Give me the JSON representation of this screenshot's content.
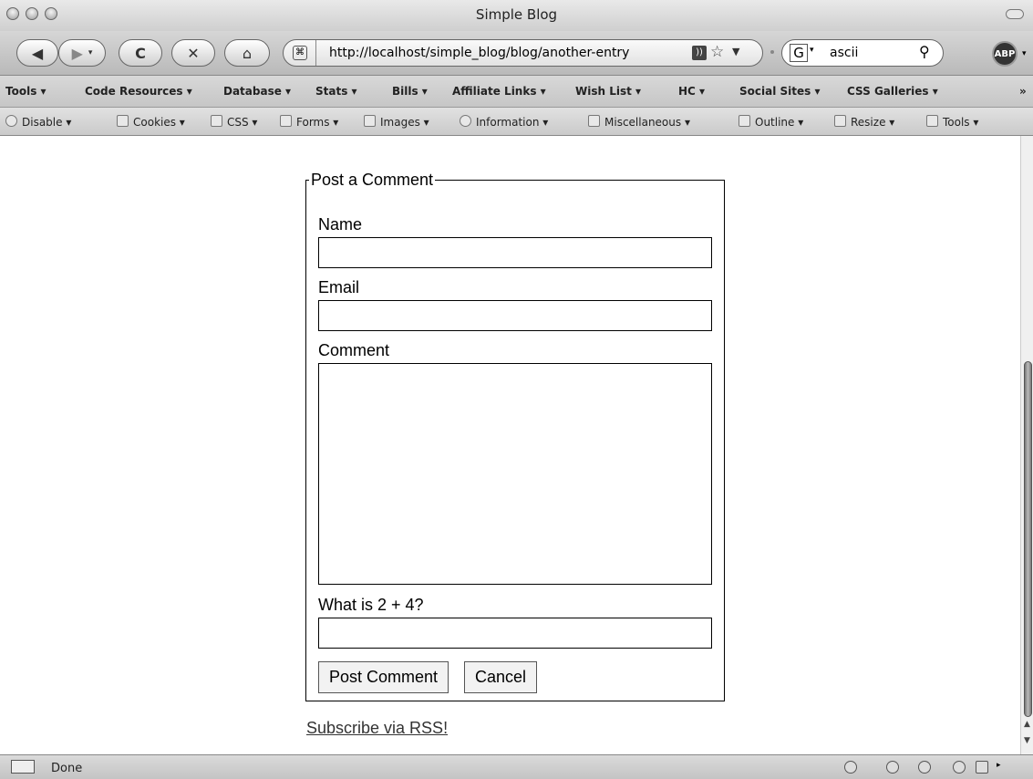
{
  "window": {
    "title": "Simple Blog"
  },
  "navigation": {
    "url": "http://localhost/simple_blog/blog/another-entry",
    "search_value": "ascii",
    "search_engine_glyph": "G",
    "adblock_label": "ABP",
    "icons": [
      "back-icon",
      "forward-icon",
      "reload-icon",
      "stop-icon",
      "home-icon",
      "site-icon",
      "rss-feed-icon",
      "bookmark-star-icon",
      "search-icon"
    ]
  },
  "bookmarks_toolbar": {
    "items": [
      "Tools ▾",
      "Code Resources ▾",
      "Database ▾",
      "Stats ▾",
      "Bills ▾",
      "Affiliate Links ▾",
      "Wish List ▾",
      "HC ▾",
      "Social Sites ▾",
      "CSS Galleries ▾"
    ],
    "overflow": "»"
  },
  "webdev_toolbar": {
    "items": [
      "Disable ▾",
      "Cookies ▾",
      "CSS ▾",
      "Forms ▾",
      "Images ▾",
      "Information ▾",
      "Miscellaneous ▾",
      "Outline ▾",
      "Resize ▾",
      "Tools ▾"
    ]
  },
  "comment_form": {
    "legend": "Post a Comment",
    "name_label": "Name",
    "name_value": "",
    "email_label": "Email",
    "email_value": "",
    "comment_label": "Comment",
    "comment_value": "",
    "captcha_label": "What is 2 + 4?",
    "captcha_value": "",
    "submit_label": "Post Comment",
    "cancel_label": "Cancel"
  },
  "rss_link": "Subscribe via RSS!",
  "status": {
    "text": "Done"
  }
}
